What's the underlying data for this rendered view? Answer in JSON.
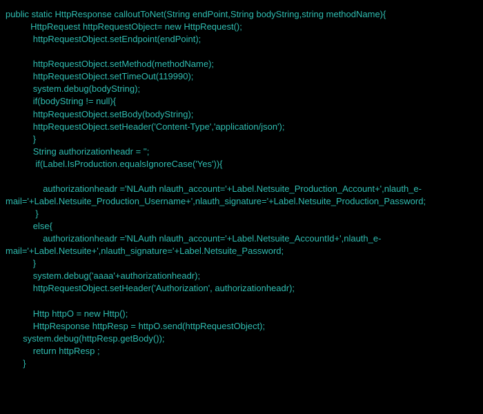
{
  "code": {
    "line1": "public static HttpResponse calloutToNet(String endPoint,String bodyString,string methodName){",
    "line2": "          HttpRequest httpRequestObject= new HttpRequest();",
    "line3": "           httpRequestObject.setEndpoint(endPoint);",
    "line4": "",
    "line5": "           httpRequestObject.setMethod(methodName);",
    "line6": "           httpRequestObject.setTimeOut(119990);",
    "line7": "           system.debug(bodyString);",
    "line8": "           if(bodyString != null){",
    "line9": "           httpRequestObject.setBody(bodyString);",
    "line10": "           httpRequestObject.setHeader('Content-Type','application/json');",
    "line11": "           }",
    "line12": "           String authorizationheadr = '';",
    "line13": "            if(Label.IsProduction.equalsIgnoreCase('Yes')){",
    "line14": "",
    "line15": "               authorizationheadr ='NLAuth nlauth_account='+Label.Netsuite_Production_Account+',nlauth_e-mail='+Label.Netsuite_Production_Username+',nlauth_signature='+Label.Netsuite_Production_Password;",
    "line16": "            }",
    "line17": "           else{",
    "line18": "               authorizationheadr ='NLAuth nlauth_account='+Label.Netsuite_AccountId+',nlauth_e-mail='+Label.Netsuite+',nlauth_signature='+Label.Netsuite_Password;",
    "line19": "           }",
    "line20": "           system.debug('aaaa'+authorizationheadr);",
    "line21": "           httpRequestObject.setHeader('Authorization', authorizationheadr);",
    "line22": "",
    "line23": "           Http httpO = new Http();",
    "line24": "           HttpResponse httpResp = httpO.send(httpRequestObject);",
    "line25": "       system.debug(httpResp.getBody());",
    "line26": "           return httpResp ;",
    "line27": "       }"
  }
}
